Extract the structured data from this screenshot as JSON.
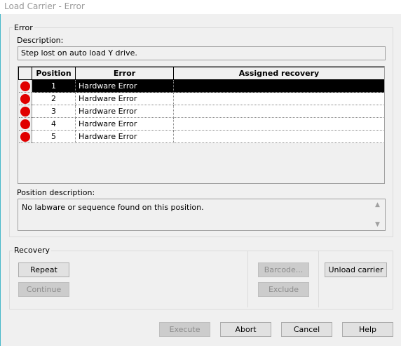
{
  "window": {
    "title": "Load Carrier - Error"
  },
  "error_group": {
    "title": "Error",
    "description_label": "Description:",
    "description_value": "Step lost on auto load Y drive.",
    "position_description_label": "Position description:",
    "position_description_value": "No labware or sequence found on this position."
  },
  "table": {
    "columns": [
      "",
      "Position",
      "Error",
      "Assigned recovery"
    ],
    "rows": [
      {
        "position": "1",
        "error": "Hardware Error",
        "recovery": "",
        "selected": true
      },
      {
        "position": "2",
        "error": "Hardware Error",
        "recovery": ""
      },
      {
        "position": "3",
        "error": "Hardware Error",
        "recovery": ""
      },
      {
        "position": "4",
        "error": "Hardware Error",
        "recovery": ""
      },
      {
        "position": "5",
        "error": "Hardware Error",
        "recovery": ""
      }
    ],
    "indicator_color": "#e00000"
  },
  "recovery_group": {
    "title": "Recovery",
    "repeat_label": "Repeat",
    "continue_label": "Continue",
    "barcode_label": "Barcode...",
    "exclude_label": "Exclude",
    "unload_label": "Unload carrier"
  },
  "footer": {
    "execute_label": "Execute",
    "abort_label": "Abort",
    "cancel_label": "Cancel",
    "help_label": "Help"
  },
  "icons": {
    "scroll_up": "▲",
    "scroll_down": "▼"
  }
}
